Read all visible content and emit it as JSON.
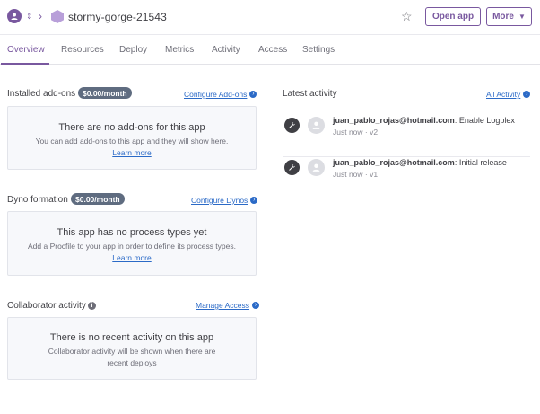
{
  "header": {
    "app_name": "stormy-gorge-21543",
    "open_app_label": "Open app",
    "more_label": "More"
  },
  "tabs": [
    {
      "label": "Overview",
      "active": true
    },
    {
      "label": "Resources"
    },
    {
      "label": "Deploy"
    },
    {
      "label": "Metrics"
    },
    {
      "label": "Activity"
    },
    {
      "label": "Access"
    },
    {
      "label": "Settings"
    }
  ],
  "addons": {
    "title": "Installed add-ons",
    "price": "$0.00/month",
    "link": "Configure Add-ons",
    "empty_title": "There are no add-ons for this app",
    "empty_body": "You can add add-ons to this app and they will show here.",
    "learn_more": "Learn more"
  },
  "dynos": {
    "title": "Dyno formation",
    "price": "$0.00/month",
    "link": "Configure Dynos",
    "empty_title": "This app has no process types yet",
    "empty_body": "Add a Procfile to your app in order to define its process types.",
    "learn_more": "Learn more"
  },
  "collab": {
    "title": "Collaborator activity",
    "link": "Manage Access",
    "empty_title": "There is no recent activity on this app",
    "empty_body": "Collaborator activity will be shown when there are recent deploys"
  },
  "activity": {
    "title": "Latest activity",
    "link": "All Activity",
    "items": [
      {
        "email": "juan_pablo_rojas@hotmail.com",
        "action": ": Enable Logplex",
        "meta": "Just now · v2"
      },
      {
        "email": "juan_pablo_rojas@hotmail.com",
        "action": ": Initial release",
        "meta": "Just now · v1"
      }
    ]
  },
  "colors": {
    "accent": "#79589f",
    "link": "#2b6ac7",
    "badge": "#5f6c80",
    "panel_bg": "#f7f8fb"
  }
}
